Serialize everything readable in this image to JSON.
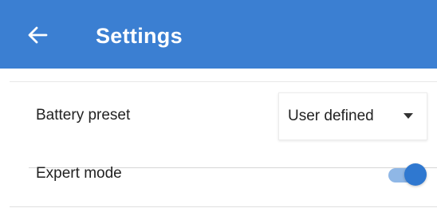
{
  "app_bar": {
    "title": "Settings",
    "back_icon": "arrow-left-icon",
    "background_color": "#3b7fd2"
  },
  "settings": {
    "battery_preset": {
      "label": "Battery preset",
      "value": "User defined",
      "dropdown_icon": "triangle-down-icon"
    },
    "expert_mode": {
      "label": "Expert mode",
      "enabled": true,
      "accent_color": "#2f78d0"
    }
  }
}
